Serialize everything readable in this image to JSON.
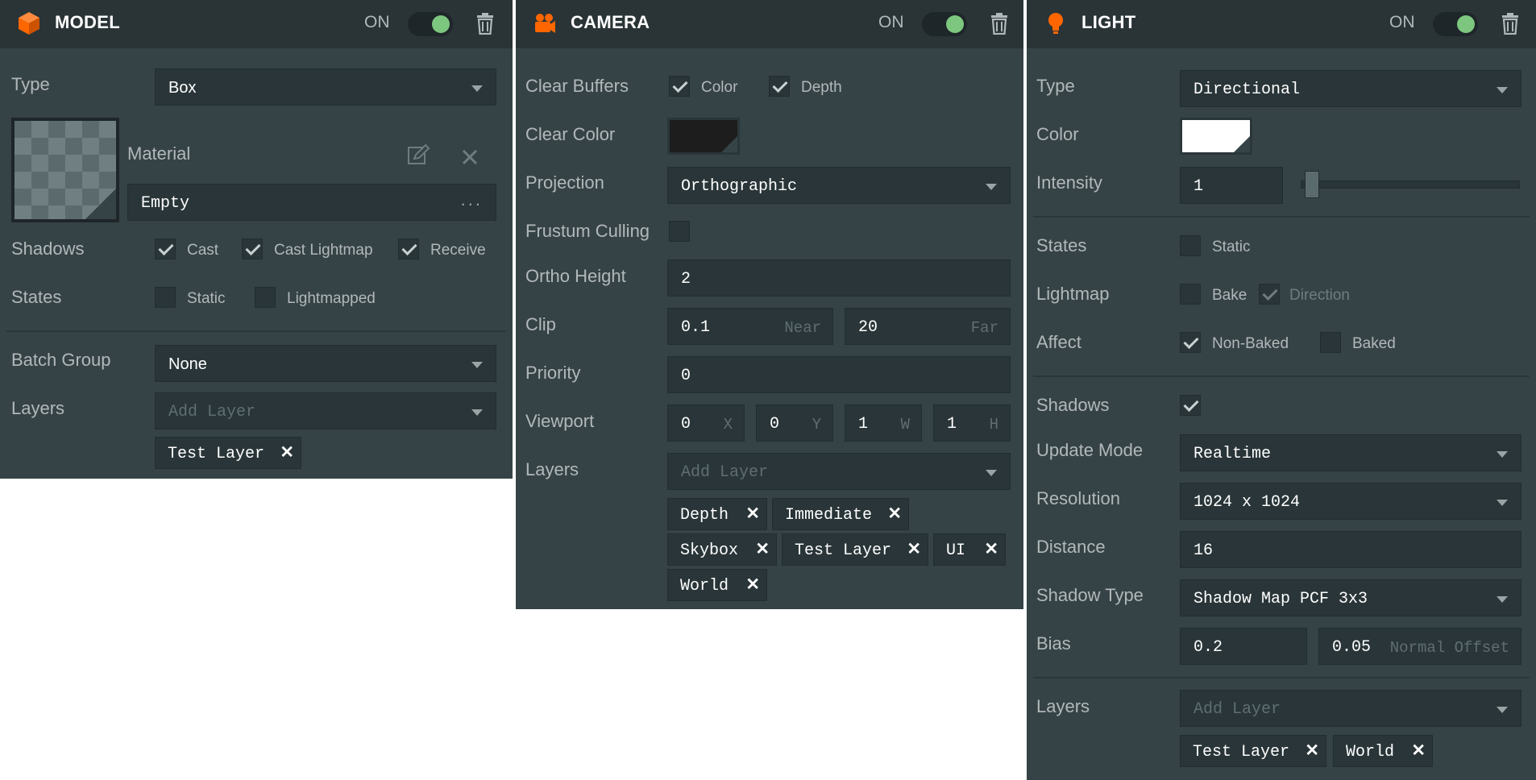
{
  "colors": {
    "accent": "#ff6600",
    "toggle_on": "#7dc67f",
    "panel_bg": "#364346",
    "header_bg": "#2a3437"
  },
  "model": {
    "title": "MODEL",
    "on_label": "ON",
    "icon": "cube-icon",
    "type_label": "Type",
    "type_value": "Box",
    "material_label": "Material",
    "material_value": "Empty",
    "material_more": "...",
    "shadows_label": "Shadows",
    "cast": "Cast",
    "cast_lightmap": "Cast Lightmap",
    "receive": "Receive",
    "states_label": "States",
    "static": "Static",
    "lightmapped": "Lightmapped",
    "batch_group_label": "Batch Group",
    "batch_group_value": "None",
    "layers_label": "Layers",
    "add_layer": "Add Layer",
    "layer_tags": [
      "Test Layer"
    ]
  },
  "camera": {
    "title": "CAMERA",
    "on_label": "ON",
    "icon": "camera-icon",
    "clear_buffers_label": "Clear Buffers",
    "color": "Color",
    "depth": "Depth",
    "clear_color_label": "Clear Color",
    "clear_color_value": "#1d1d1d",
    "projection_label": "Projection",
    "projection_value": "Orthographic",
    "frustum_label": "Frustum Culling",
    "ortho_height_label": "Ortho Height",
    "ortho_height_value": "2",
    "clip_label": "Clip",
    "clip_near": "0.1",
    "near_hint": "Near",
    "clip_far": "20",
    "far_hint": "Far",
    "priority_label": "Priority",
    "priority_value": "0",
    "viewport_label": "Viewport",
    "viewport": [
      {
        "value": "0",
        "hint": "X"
      },
      {
        "value": "0",
        "hint": "Y"
      },
      {
        "value": "1",
        "hint": "W"
      },
      {
        "value": "1",
        "hint": "H"
      }
    ],
    "layers_label": "Layers",
    "add_layer": "Add Layer",
    "layer_tags": [
      "Depth",
      "Immediate",
      "Skybox",
      "Test Layer",
      "UI",
      "World"
    ]
  },
  "light": {
    "title": "LIGHT",
    "on_label": "ON",
    "icon": "light-bulb-icon",
    "type_label": "Type",
    "type_value": "Directional",
    "color_label": "Color",
    "color_value": "#ffffff",
    "intensity_label": "Intensity",
    "intensity_value": "1",
    "intensity_slider": 0.05,
    "states_label": "States",
    "static": "Static",
    "lightmap_label": "Lightmap",
    "bake": "Bake",
    "direction": "Direction",
    "affect_label": "Affect",
    "non_baked": "Non-Baked",
    "baked": "Baked",
    "shadows_label": "Shadows",
    "update_mode_label": "Update Mode",
    "update_mode_value": "Realtime",
    "resolution_label": "Resolution",
    "resolution_value": "1024 x 1024",
    "distance_label": "Distance",
    "distance_value": "16",
    "shadow_type_label": "Shadow Type",
    "shadow_type_value": "Shadow Map PCF 3x3",
    "bias_label": "Bias",
    "bias_value": "0.2",
    "normal_offset_value": "0.05",
    "normal_offset_hint": "Normal Offset",
    "layers_label": "Layers",
    "add_layer": "Add Layer",
    "layer_tags": [
      "Test Layer",
      "World"
    ]
  }
}
